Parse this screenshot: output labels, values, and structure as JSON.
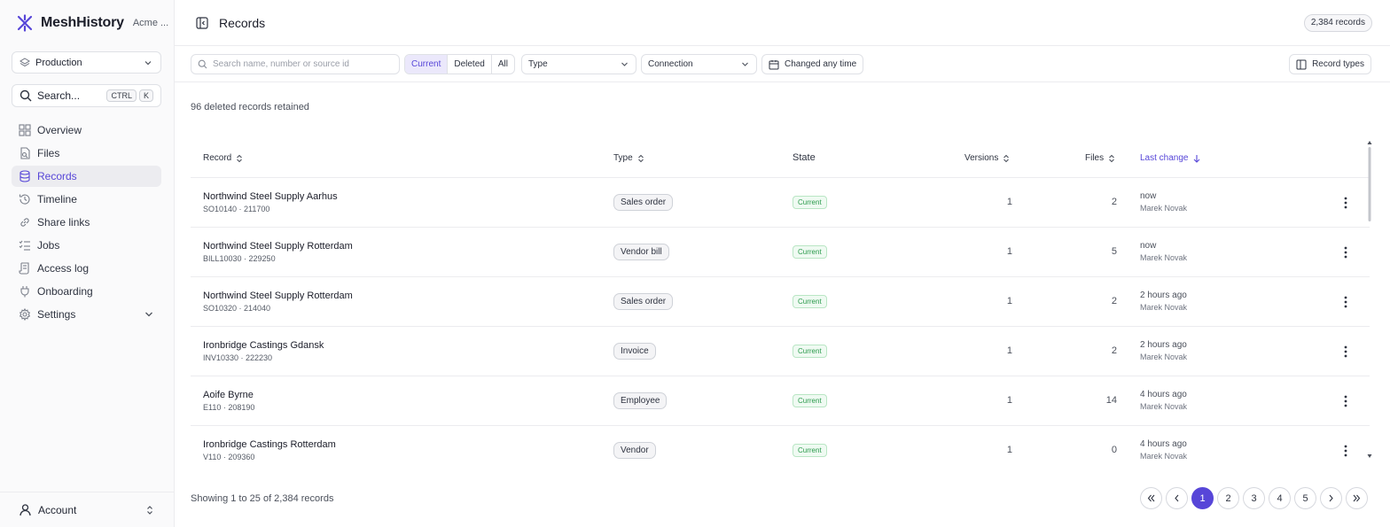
{
  "brand": {
    "name": "MeshHistory",
    "org": "Acme ..."
  },
  "sidebar": {
    "environment": "Production",
    "search": {
      "label": "Search...",
      "kbd": [
        "CTRL",
        "K"
      ]
    },
    "items": [
      {
        "label": "Overview",
        "icon": "grid-icon"
      },
      {
        "label": "Files",
        "icon": "file-search-icon"
      },
      {
        "label": "Records",
        "icon": "database-icon"
      },
      {
        "label": "Timeline",
        "icon": "history-icon"
      },
      {
        "label": "Share links",
        "icon": "link-icon"
      },
      {
        "label": "Jobs",
        "icon": "list-checks-icon"
      },
      {
        "label": "Access log",
        "icon": "scroll-icon"
      },
      {
        "label": "Onboarding",
        "icon": "plug-icon"
      },
      {
        "label": "Settings",
        "icon": "gear-icon"
      }
    ],
    "account": "Account"
  },
  "header": {
    "title": "Records",
    "count": "2,384 records"
  },
  "filters": {
    "search_placeholder": "Search name, number or source id",
    "segments": [
      "Current",
      "Deleted",
      "All"
    ],
    "type": "Type",
    "connection": "Connection",
    "changed": "Changed any time",
    "record_types": "Record types"
  },
  "retained": "96 deleted records retained",
  "table": {
    "columns": {
      "record": "Record",
      "type": "Type",
      "state": "State",
      "versions": "Versions",
      "files": "Files",
      "last_change": "Last change"
    },
    "rows": [
      {
        "name": "Northwind Steel Supply Aarhus",
        "sub": "SO10140 · 211700",
        "type": "Sales order",
        "state": "Current",
        "versions": "1",
        "files": "2",
        "when": "now",
        "who": "Marek Novak"
      },
      {
        "name": "Northwind Steel Supply Rotterdam",
        "sub": "BILL10030 · 229250",
        "type": "Vendor bill",
        "state": "Current",
        "versions": "1",
        "files": "5",
        "when": "now",
        "who": "Marek Novak"
      },
      {
        "name": "Northwind Steel Supply Rotterdam",
        "sub": "SO10320 · 214040",
        "type": "Sales order",
        "state": "Current",
        "versions": "1",
        "files": "2",
        "when": "2 hours ago",
        "who": "Marek Novak"
      },
      {
        "name": "Ironbridge Castings Gdansk",
        "sub": "INV10330 · 222230",
        "type": "Invoice",
        "state": "Current",
        "versions": "1",
        "files": "2",
        "when": "2 hours ago",
        "who": "Marek Novak"
      },
      {
        "name": "Aoife Byrne",
        "sub": "E110 · 208190",
        "type": "Employee",
        "state": "Current",
        "versions": "1",
        "files": "14",
        "when": "4 hours ago",
        "who": "Marek Novak"
      },
      {
        "name": "Ironbridge Castings Rotterdam",
        "sub": "V110 · 209360",
        "type": "Vendor",
        "state": "Current",
        "versions": "1",
        "files": "0",
        "when": "4 hours ago",
        "who": "Marek Novak"
      }
    ]
  },
  "footer": {
    "showing": "Showing 1 to 25 of 2,384 records",
    "pages": [
      "1",
      "2",
      "3",
      "4",
      "5"
    ]
  },
  "colors": {
    "accent": "#5746d8",
    "current_green": "#2a9a4b"
  }
}
